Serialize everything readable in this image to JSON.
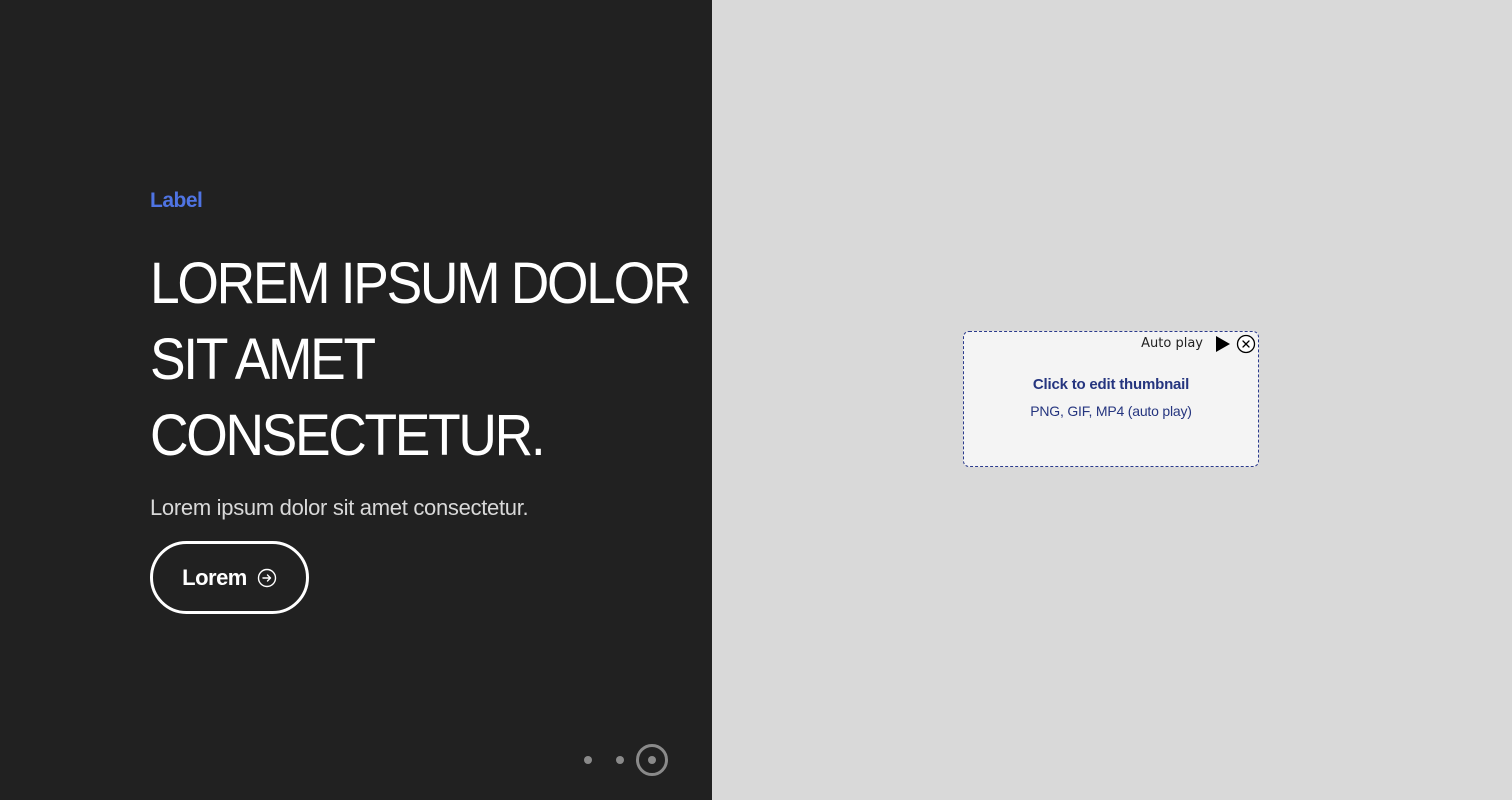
{
  "hero": {
    "eyebrow": "Label",
    "headline_lines": [
      "LOREM IPSUM DOLOR",
      "SIT AMET",
      "CONSECTETUR."
    ],
    "subtitle": "Lorem ipsum dolor sit amet consectetur.",
    "cta_label": "Lorem",
    "cta_icon": "arrow-right-circle-icon"
  },
  "pager": {
    "count": 3,
    "active_index": 3
  },
  "thumbnail": {
    "autoplay_label": "Auto play",
    "title": "Click to edit thumbnail",
    "formats": "PNG, GIF, MP4 (auto play)",
    "play_icon": "play-icon",
    "close_icon": "close-icon"
  },
  "colors": {
    "left_bg": "#212121",
    "right_bg": "#d9d9d9",
    "accent": "#4f74e3",
    "thumb_text": "#25357f"
  }
}
